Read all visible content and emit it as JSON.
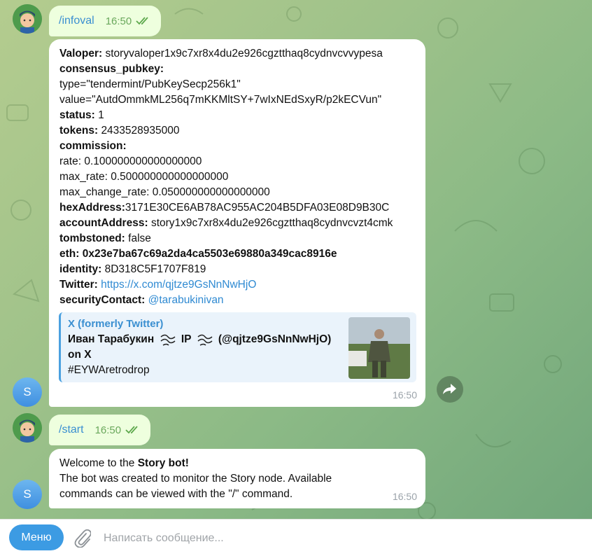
{
  "messages": {
    "cmd1": {
      "text": "/infoval",
      "time": "16:50"
    },
    "info": {
      "valoper_k": "Valoper:",
      "valoper_v": "storyvaloper1x9c7xr8x4du2e926cgztthaq8cydnvcvvypesa",
      "pubkey_k": "consensus_pubkey:",
      "type_line": "type=\"tendermint/PubKeySecp256k1\"",
      "value_line": "value=\"AutdOmmkML256q7mKKMltSY+7wIxNEdSxyR/p2kECVun\"",
      "status_k": "status:",
      "status_v": "1",
      "tokens_k": "tokens:",
      "tokens_v": "2433528935000",
      "commission_k": "commission:",
      "rate_line": "rate: 0.100000000000000000",
      "max_rate_line": "max_rate: 0.500000000000000000",
      "max_change_line": "max_change_rate: 0.050000000000000000",
      "hex_k": "hexAddress:",
      "hex_v": "3171E30CE6AB78AC955AC204B5DFA03E08D9B30C",
      "acct_k": "accountAddress:",
      "acct_v": "story1x9c7xr8x4du2e926cgztthaq8cydnvcvzt4cmk",
      "tomb_k": "tombstoned:",
      "tomb_v": "false",
      "eth_line": "eth: 0x23e7ba67c69a2da4ca5503e69880a349cac8916e",
      "identity_k": "identity:",
      "identity_v": "8D318C5F1707F819",
      "twitter_k": "Twitter:",
      "twitter_v": "https://x.com/qjtze9GsNnNwHjO",
      "security_k": "securityContact:",
      "security_v": "@tarabukinivan",
      "preview": {
        "title": "X (formerly Twitter)",
        "name": "Иван Тарабукин",
        "ip": "IP",
        "handle": "(@qjtze9GsNnNwHjO)",
        "on_x": "on X",
        "hashtag": "#EYWAretrodrop"
      },
      "time": "16:50"
    },
    "cmd2": {
      "text": "/start",
      "time": "16:50"
    },
    "welcome": {
      "line1_a": "Welcome to the ",
      "line1_b": "Story bot!",
      "line2": "The bot was created to monitor the Story node. Available",
      "line3": "commands can be viewed with the \"/\" command.",
      "time": "16:50"
    }
  },
  "bot_avatar_letter": "S",
  "input": {
    "menu_label": "Меню",
    "placeholder": "Написать сообщение..."
  },
  "colors": {
    "accent": "#3c9be3",
    "outgoing_bubble": "#eeffde",
    "link": "#2f8ad2"
  }
}
